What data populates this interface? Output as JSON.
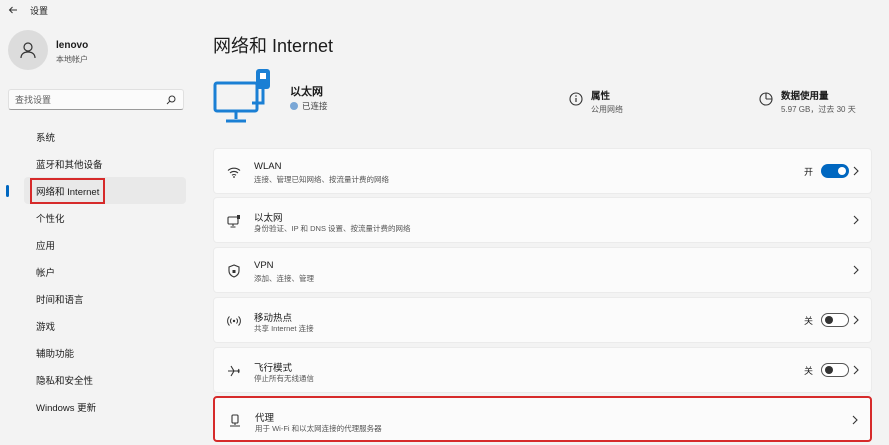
{
  "app": {
    "title": "设置"
  },
  "user": {
    "name": "lenovo",
    "account_type": "本地帐户"
  },
  "search": {
    "placeholder": "查找设置"
  },
  "nav": [
    {
      "label": "系统"
    },
    {
      "label": "蓝牙和其他设备"
    },
    {
      "label": "网络和 Internet",
      "active": true
    },
    {
      "label": "个性化"
    },
    {
      "label": "应用"
    },
    {
      "label": "帐户"
    },
    {
      "label": "时间和语言"
    },
    {
      "label": "游戏"
    },
    {
      "label": "辅助功能"
    },
    {
      "label": "隐私和安全性"
    },
    {
      "label": "Windows 更新"
    }
  ],
  "page": {
    "title": "网络和 Internet"
  },
  "hero": {
    "name": "以太网",
    "status": "已连接"
  },
  "properties": {
    "title": "属性",
    "subtitle": "公用网络"
  },
  "data_usage": {
    "title": "数据使用量",
    "subtitle": "5.97 GB，过去 30 天"
  },
  "cards": [
    {
      "id": "wlan",
      "icon": "wifi-icon",
      "title": "WLAN",
      "subtitle": "连接、管理已知网络、按流量计费的网络",
      "toggle": "on",
      "toggle_label": "开"
    },
    {
      "id": "ethernet",
      "icon": "ethernet-icon",
      "title": "以太网",
      "subtitle": "身份验证、IP 和 DNS 设置、按流量计费的网络"
    },
    {
      "id": "vpn",
      "icon": "shield-icon",
      "title": "VPN",
      "subtitle": "添加、连接、管理"
    },
    {
      "id": "hotspot",
      "icon": "hotspot-icon",
      "title": "移动热点",
      "subtitle": "共享 Internet 连接",
      "toggle": "off",
      "toggle_label": "关"
    },
    {
      "id": "airplane",
      "icon": "airplane-icon",
      "title": "飞行模式",
      "subtitle": "停止所有无线通信",
      "toggle": "off",
      "toggle_label": "关"
    },
    {
      "id": "proxy",
      "icon": "proxy-icon",
      "title": "代理",
      "subtitle": "用于 Wi-Fi 和以太网连接的代理服务器"
    }
  ],
  "colors": {
    "accent": "#0067c0",
    "highlight": "#d62a2a",
    "background": "#f3f3f3",
    "card": "#fbfbfb"
  }
}
